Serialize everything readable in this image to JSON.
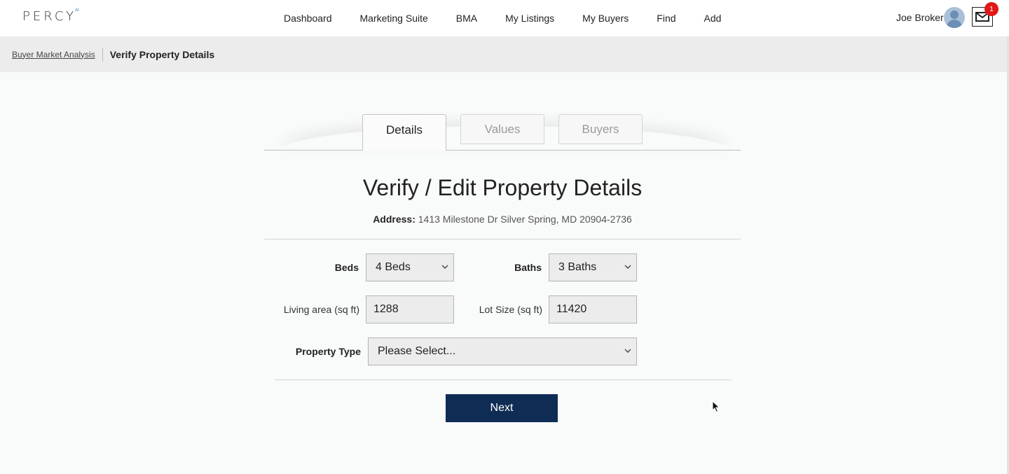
{
  "brand": {
    "logo_text": "PERCY",
    "logo_sup": "AI"
  },
  "nav": [
    {
      "label": "Dashboard"
    },
    {
      "label": "Marketing Suite"
    },
    {
      "label": "BMA"
    },
    {
      "label": "My Listings"
    },
    {
      "label": "My Buyers"
    },
    {
      "label": "Find"
    },
    {
      "label": "Add"
    }
  ],
  "user": {
    "name": "Joe Broker",
    "unread_count": "1"
  },
  "breadcrumb": {
    "parent": "Buyer Market Analysis",
    "current": "Verify Property Details"
  },
  "tabs": [
    {
      "label": "Details",
      "active": true
    },
    {
      "label": "Values",
      "active": false
    },
    {
      "label": "Buyers",
      "active": false
    }
  ],
  "form": {
    "title": "Verify / Edit Property Details",
    "address_label": "Address:",
    "address_value": "1413 Milestone Dr Silver Spring, MD 20904-2736",
    "beds": {
      "label": "Beds",
      "value": "4 Beds"
    },
    "baths": {
      "label": "Baths",
      "value": "3 Baths"
    },
    "living_area": {
      "label": "Living area (sq ft)",
      "value": "1288"
    },
    "lot_size": {
      "label": "Lot Size (sq ft)",
      "value": "11420"
    },
    "property_type": {
      "label": "Property Type",
      "value": "Please Select..."
    },
    "next_label": "Next"
  },
  "colors": {
    "primary_button": "#0f2c54",
    "badge": "#e01818",
    "breadcrumb_bg": "#ececec"
  }
}
